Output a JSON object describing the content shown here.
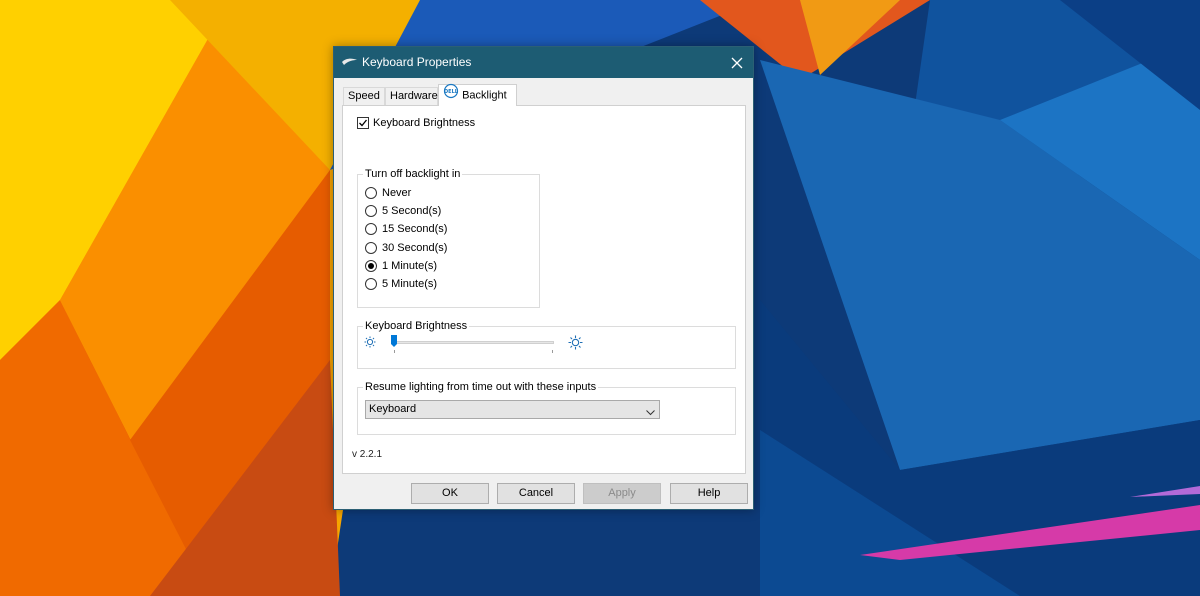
{
  "window": {
    "title": "Keyboard Properties",
    "app_icon": "keyboard-icon",
    "close_icon": "close-icon"
  },
  "tabs": [
    {
      "label": "Speed",
      "active": false
    },
    {
      "label": "Hardware",
      "active": false
    },
    {
      "label": "Backlight",
      "active": true,
      "icon": "dell-logo-icon"
    }
  ],
  "brightness_checkbox": {
    "label": "Keyboard Brightness",
    "checked": true
  },
  "timeout_group": {
    "legend": "Turn off backlight in",
    "options": [
      "Never",
      "5 Second(s)",
      "15 Second(s)",
      "30 Second(s)",
      "1 Minute(s)",
      "5 Minute(s)"
    ],
    "selected": "1 Minute(s)"
  },
  "brightness_group": {
    "legend": "Keyboard Brightness",
    "slider_value": 0,
    "low_icon": "dim-sun-icon",
    "high_icon": "bright-sun-icon"
  },
  "resume_group": {
    "legend": "Resume lighting from time out with these inputs",
    "selected": "Keyboard"
  },
  "version": "v 2.2.1",
  "buttons": {
    "ok": "OK",
    "cancel": "Cancel",
    "apply": "Apply",
    "help": "Help"
  },
  "colors": {
    "titlebar": "#1d5c73",
    "accent": "#0078d7"
  }
}
